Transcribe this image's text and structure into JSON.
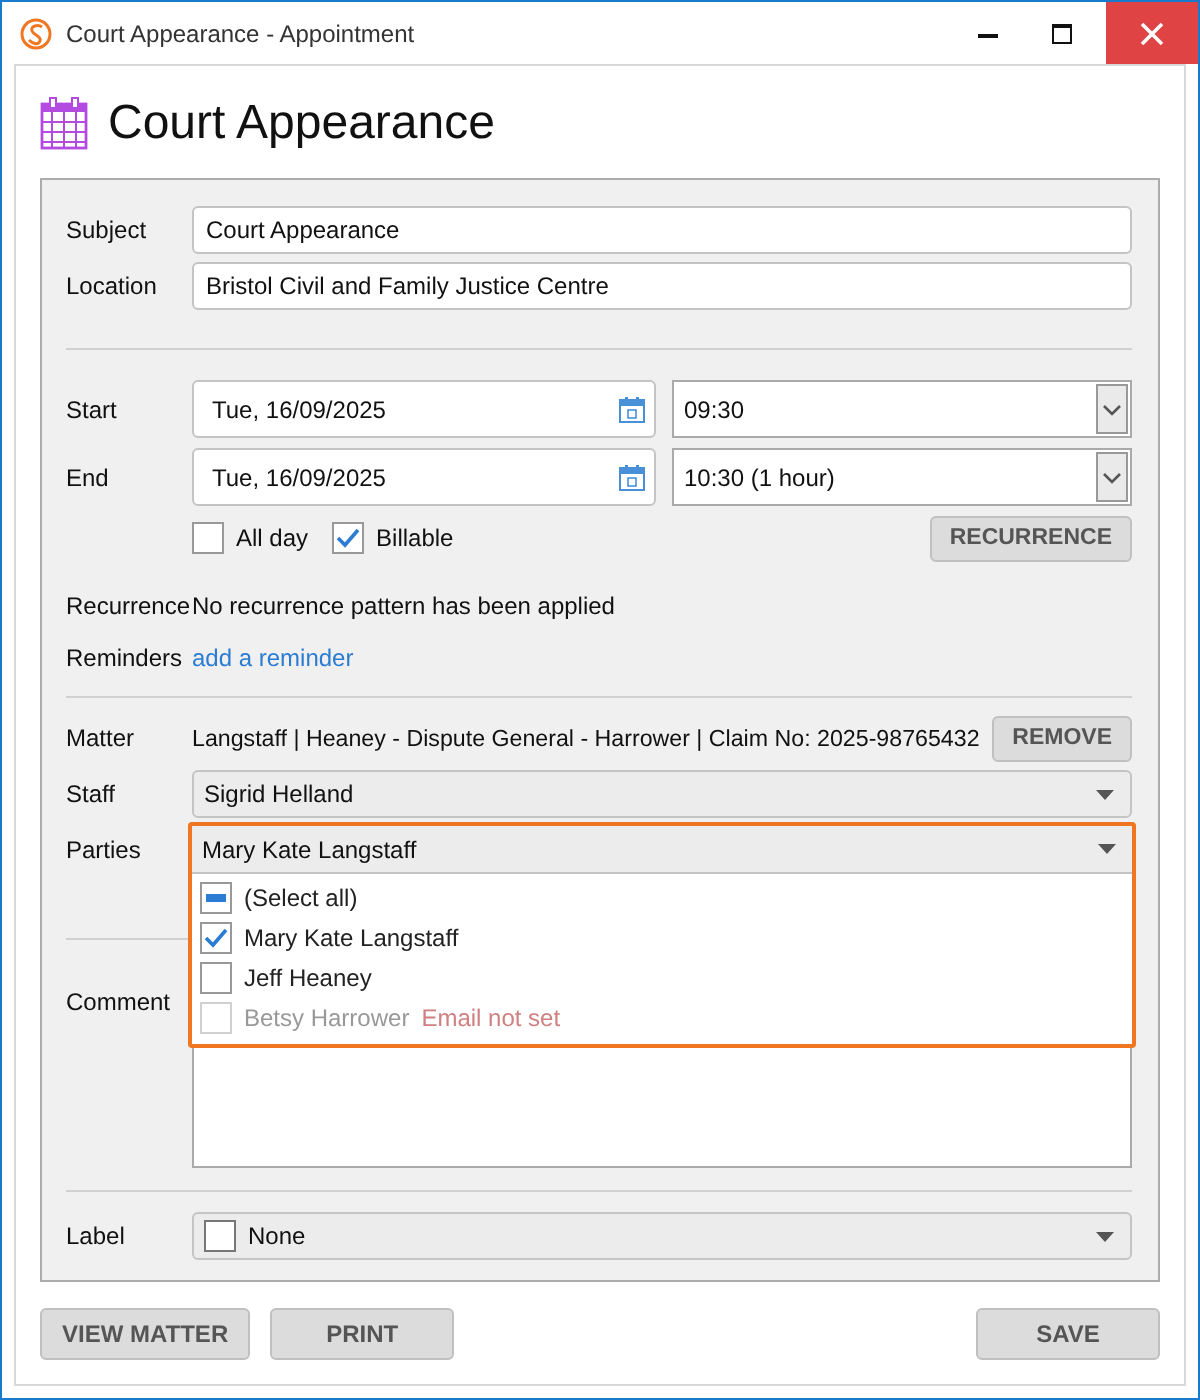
{
  "window": {
    "title": "Court Appearance - Appointment"
  },
  "heading": "Court Appearance",
  "subject": {
    "label": "Subject",
    "value": "Court Appearance"
  },
  "location": {
    "label": "Location",
    "value": "Bristol Civil and Family Justice Centre"
  },
  "start": {
    "label": "Start",
    "date": "Tue, 16/09/2025",
    "time": "09:30"
  },
  "end": {
    "label": "End",
    "date": "Tue, 16/09/2025",
    "time": "10:30 (1 hour)"
  },
  "options": [
    {
      "label": "All day",
      "checked": false
    },
    {
      "label": "Billable",
      "checked": true
    }
  ],
  "recurrence_button": "RECURRENCE",
  "recurrence": {
    "label": "Recurrence",
    "value": "No recurrence pattern has been applied"
  },
  "reminders": {
    "label": "Reminders",
    "link": "add a reminder"
  },
  "matter": {
    "label": "Matter",
    "value": "Langstaff | Heaney - Dispute General - Harrower | Claim No: 2025-98765432",
    "button": "REMOVE"
  },
  "staff": {
    "label": "Staff",
    "value": "Sigrid Helland"
  },
  "parties": {
    "label": "Parties",
    "value": "Mary Kate Langstaff",
    "expanded": true,
    "options": [
      {
        "name": "(Select all)",
        "checked": false,
        "indeterminate": true,
        "disabled": false
      },
      {
        "name": "Mary Kate Langstaff",
        "checked": true,
        "indeterminate": false,
        "disabled": false
      },
      {
        "name": "Jeff Heaney",
        "checked": false,
        "indeterminate": false,
        "disabled": false
      },
      {
        "name": "Betsy Harrower",
        "checked": false,
        "indeterminate": false,
        "disabled": true,
        "note": "Email not set"
      }
    ]
  },
  "comment": {
    "label": "Comment"
  },
  "label_field": {
    "label": "Label",
    "value": "None"
  },
  "buttons_left": [
    "VIEW MATTER",
    "PRINT"
  ],
  "buttons_right": [
    "SAVE"
  ]
}
